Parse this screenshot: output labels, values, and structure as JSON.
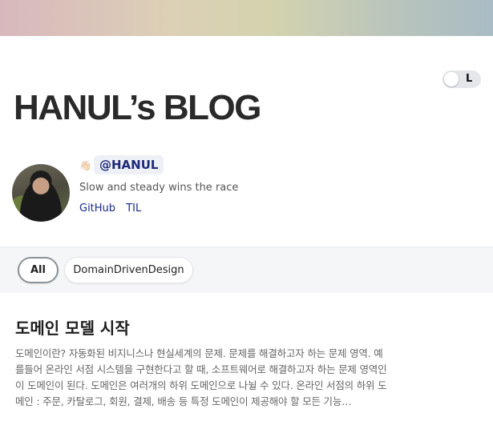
{
  "blog": {
    "title": "HANUL’s BLOG"
  },
  "theme_toggle": {
    "mode_label": "L"
  },
  "profile": {
    "wave_icon": "waving-hand",
    "handle": "@HANUL",
    "bio": "Slow and steady wins the race",
    "links": [
      "GitHub",
      "TIL"
    ]
  },
  "tags": {
    "items": [
      "All",
      "DomainDrivenDesign"
    ],
    "selected": "All"
  },
  "post": {
    "title": "도메인 모델 시작",
    "excerpt_lines": [
      "도메인이란? 자동화된 비지니스나 현실세계의 문제. 문제를 해결하고자 하는 문제 영역. 예",
      "를들어 온라인 서점 시스템을 구현한다고 할 때, 소프트웨어로 해결하고자 하는 문제 영역인",
      "이 도메인이 된다. 도메인은 여러개의 하위 도메인으로 나뉠 수 있다. 온라인 서점의 하위 도",
      "메인 : 주문, 카탈로그, 회원, 결제, 배송 등 특정 도메인이 제공해야 할 모든 기능…"
    ]
  }
}
